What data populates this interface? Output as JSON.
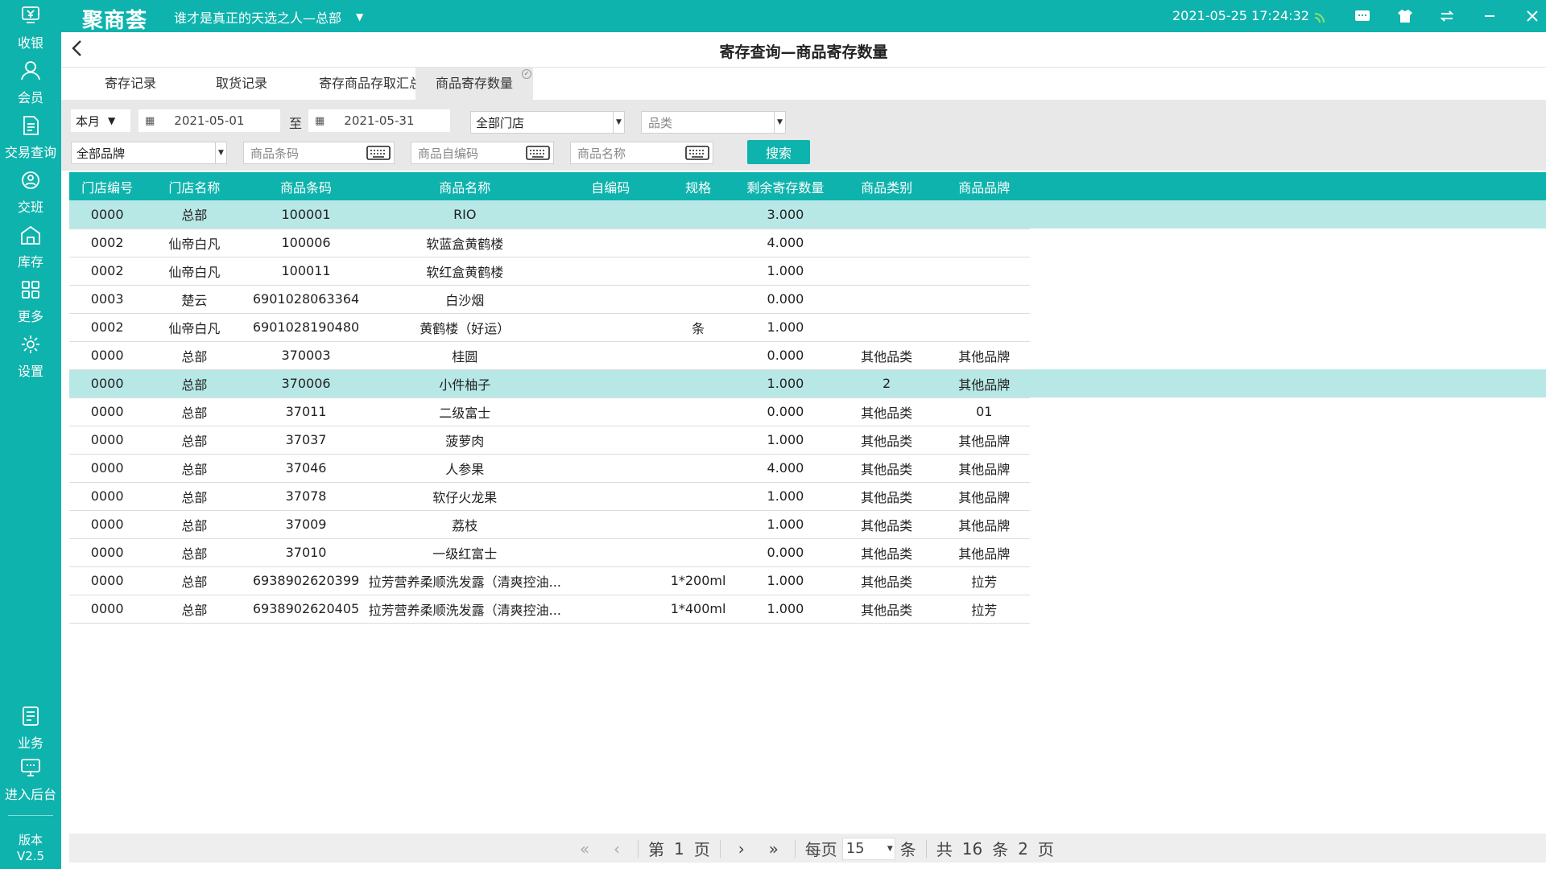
{
  "app": {
    "logo": "聚商荟",
    "store_name": "谁才是真正的天选之人—总部",
    "datetime": "2021-05-25 17:24:32"
  },
  "sidebar": {
    "items": [
      {
        "label": "收银",
        "icon": "cashier-icon"
      },
      {
        "label": "会员",
        "icon": "member-icon"
      },
      {
        "label": "交易查询",
        "icon": "document-icon"
      },
      {
        "label": "交班",
        "icon": "shift-icon"
      },
      {
        "label": "库存",
        "icon": "warehouse-icon"
      },
      {
        "label": "更多",
        "icon": "grid-icon"
      },
      {
        "label": "设置",
        "icon": "gear-icon"
      }
    ],
    "bottom_items": [
      {
        "label": "业务",
        "icon": "business-icon"
      },
      {
        "label": "进入后台",
        "icon": "monitor-icon"
      }
    ],
    "version_label": "版本",
    "version": "V2.5"
  },
  "page": {
    "title": "寄存查询—商品寄存数量"
  },
  "tabs": [
    {
      "label": "寄存记录",
      "active": false
    },
    {
      "label": "取货记录",
      "active": false
    },
    {
      "label": "寄存商品存取汇总",
      "active": false
    },
    {
      "label": "商品寄存数量",
      "active": true
    }
  ],
  "filters": {
    "period": "本月",
    "date_from": "2021-05-01",
    "to_label": "至",
    "date_to": "2021-05-31",
    "store": "全部门店",
    "category_placeholder": "品类",
    "brand": "全部品牌",
    "barcode_placeholder": "商品条码",
    "selfcode_placeholder": "商品自编码",
    "name_placeholder": "商品名称",
    "search_label": "搜索"
  },
  "table": {
    "columns": [
      "门店编号",
      "门店名称",
      "商品条码",
      "商品名称",
      "自编码",
      "规格",
      "剩余寄存数量",
      "商品类别",
      "商品品牌"
    ],
    "rows": [
      {
        "store_no": "0000",
        "store_name": "总部",
        "barcode": "100001",
        "name": "RIO",
        "selfcode": "",
        "spec": "",
        "qty": "3.000",
        "category": "",
        "brand": "",
        "selected": true
      },
      {
        "store_no": "0002",
        "store_name": "仙帝白凡",
        "barcode": "100006",
        "name": "软蓝盒黄鹤楼",
        "selfcode": "",
        "spec": "",
        "qty": "4.000",
        "category": "",
        "brand": "",
        "selected": false
      },
      {
        "store_no": "0002",
        "store_name": "仙帝白凡",
        "barcode": "100011",
        "name": "软红盒黄鹤楼",
        "selfcode": "",
        "spec": "",
        "qty": "1.000",
        "category": "",
        "brand": "",
        "selected": false
      },
      {
        "store_no": "0003",
        "store_name": "楚云",
        "barcode": "6901028063364",
        "name": "白沙烟",
        "selfcode": "",
        "spec": "",
        "qty": "0.000",
        "category": "",
        "brand": "",
        "selected": false
      },
      {
        "store_no": "0002",
        "store_name": "仙帝白凡",
        "barcode": "6901028190480",
        "name": "黄鹤楼（好运）",
        "selfcode": "",
        "spec": "条",
        "qty": "1.000",
        "category": "",
        "brand": "",
        "selected": false
      },
      {
        "store_no": "0000",
        "store_name": "总部",
        "barcode": "370003",
        "name": "桂圆",
        "selfcode": "",
        "spec": "",
        "qty": "0.000",
        "category": "其他品类",
        "brand": "其他品牌",
        "selected": false
      },
      {
        "store_no": "0000",
        "store_name": "总部",
        "barcode": "370006",
        "name": "小件柚子",
        "selfcode": "",
        "spec": "",
        "qty": "1.000",
        "category": "2",
        "brand": "其他品牌",
        "selected": true
      },
      {
        "store_no": "0000",
        "store_name": "总部",
        "barcode": "37011",
        "name": "二级富士",
        "selfcode": "",
        "spec": "",
        "qty": "0.000",
        "category": "其他品类",
        "brand": "01",
        "selected": false
      },
      {
        "store_no": "0000",
        "store_name": "总部",
        "barcode": "37037",
        "name": "菠萝肉",
        "selfcode": "",
        "spec": "",
        "qty": "1.000",
        "category": "其他品类",
        "brand": "其他品牌",
        "selected": false
      },
      {
        "store_no": "0000",
        "store_name": "总部",
        "barcode": "37046",
        "name": "人参果",
        "selfcode": "",
        "spec": "",
        "qty": "4.000",
        "category": "其他品类",
        "brand": "其他品牌",
        "selected": false
      },
      {
        "store_no": "0000",
        "store_name": "总部",
        "barcode": "37078",
        "name": "软仔火龙果",
        "selfcode": "",
        "spec": "",
        "qty": "1.000",
        "category": "其他品类",
        "brand": "其他品牌",
        "selected": false
      },
      {
        "store_no": "0000",
        "store_name": "总部",
        "barcode": "37009",
        "name": "荔枝",
        "selfcode": "",
        "spec": "",
        "qty": "1.000",
        "category": "其他品类",
        "brand": "其他品牌",
        "selected": false
      },
      {
        "store_no": "0000",
        "store_name": "总部",
        "barcode": "37010",
        "name": "一级红富士",
        "selfcode": "",
        "spec": "",
        "qty": "0.000",
        "category": "其他品类",
        "brand": "其他品牌",
        "selected": false
      },
      {
        "store_no": "0000",
        "store_name": "总部",
        "barcode": "6938902620399",
        "name": "拉芳营养柔顺洗发露（清爽控油...",
        "selfcode": "",
        "spec": "1*200ml",
        "qty": "1.000",
        "category": "其他品类",
        "brand": "拉芳",
        "selected": false
      },
      {
        "store_no": "0000",
        "store_name": "总部",
        "barcode": "6938902620405",
        "name": "拉芳营养柔顺洗发露（清爽控油...",
        "selfcode": "",
        "spec": "1*400ml",
        "qty": "1.000",
        "category": "其他品类",
        "brand": "拉芳",
        "selected": false
      }
    ]
  },
  "pager": {
    "first": "«",
    "prev": "‹",
    "page_prefix": "第",
    "page": "1",
    "page_suffix": "页",
    "next": "›",
    "last": "»",
    "per_page_prefix": "每页",
    "per_page": "15",
    "per_page_suffix": "条",
    "total_prefix": "共",
    "total": "16",
    "total_suffix": "条",
    "pages": "2",
    "pages_suffix": "页"
  },
  "colors": {
    "brand": "#0fb3ad",
    "selected_row": "#b8e8e6",
    "filter_bg": "#e8e8e8"
  }
}
